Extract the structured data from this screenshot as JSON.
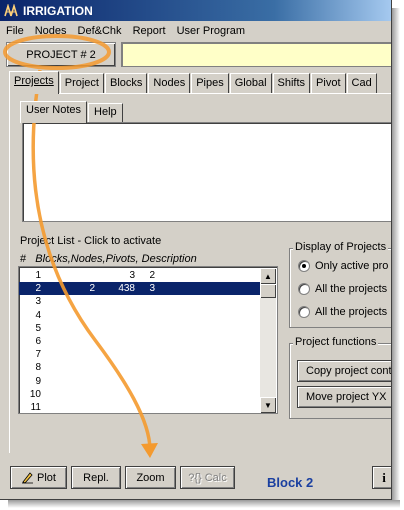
{
  "window": {
    "title": "IRRIGATION",
    "accent": "#0a246a",
    "highlight": "#f49a2f"
  },
  "menu": {
    "items": [
      "File",
      "Nodes",
      "Def&Chk",
      "Report",
      "User Program"
    ]
  },
  "project_bar": {
    "button_label": "PROJECT # 2",
    "field_value": "",
    "field_color": "#ffffc8"
  },
  "tabs": [
    "Projects",
    "Project",
    "Blocks",
    "Nodes",
    "Pipes",
    "Global",
    "Shifts",
    "Pivot",
    "Cad"
  ],
  "subtabs": [
    "User Notes",
    "Help"
  ],
  "notes_text": "",
  "project_list": {
    "title": "Project List - Click to activate",
    "header_hash": "#",
    "header_columns": "Blocks,Nodes,Pivots,  Description",
    "rows": [
      {
        "num": "1",
        "blocks": "",
        "nodes": "3",
        "pivots": "2",
        "selected": false
      },
      {
        "num": "2",
        "blocks": "2",
        "nodes": "438",
        "pivots": "3",
        "selected": true
      },
      {
        "num": "3",
        "blocks": "",
        "nodes": "",
        "pivots": "",
        "selected": false
      },
      {
        "num": "4",
        "blocks": "",
        "nodes": "",
        "pivots": "",
        "selected": false
      },
      {
        "num": "5",
        "blocks": "",
        "nodes": "",
        "pivots": "",
        "selected": false
      },
      {
        "num": "6",
        "blocks": "",
        "nodes": "",
        "pivots": "",
        "selected": false
      },
      {
        "num": "7",
        "blocks": "",
        "nodes": "",
        "pivots": "",
        "selected": false
      },
      {
        "num": "8",
        "blocks": "",
        "nodes": "",
        "pivots": "",
        "selected": false
      },
      {
        "num": "9",
        "blocks": "",
        "nodes": "",
        "pivots": "",
        "selected": false
      },
      {
        "num": "10",
        "blocks": "",
        "nodes": "",
        "pivots": "",
        "selected": false
      },
      {
        "num": "11",
        "blocks": "",
        "nodes": "",
        "pivots": "",
        "selected": false
      }
    ]
  },
  "display": {
    "title": "Display of Projects",
    "options": [
      {
        "label": "Only active pro",
        "selected": true
      },
      {
        "label": "All the projects",
        "selected": false
      },
      {
        "label": "All the projects",
        "selected": false
      }
    ]
  },
  "functions": {
    "title": "Project functions",
    "buttons": [
      "Copy project cont",
      "Move project YX"
    ]
  },
  "bottom": {
    "plot": "Plot",
    "repl": "Repl.",
    "zoom": "Zoom",
    "calc": "Calc",
    "block_label": "Block 2"
  }
}
